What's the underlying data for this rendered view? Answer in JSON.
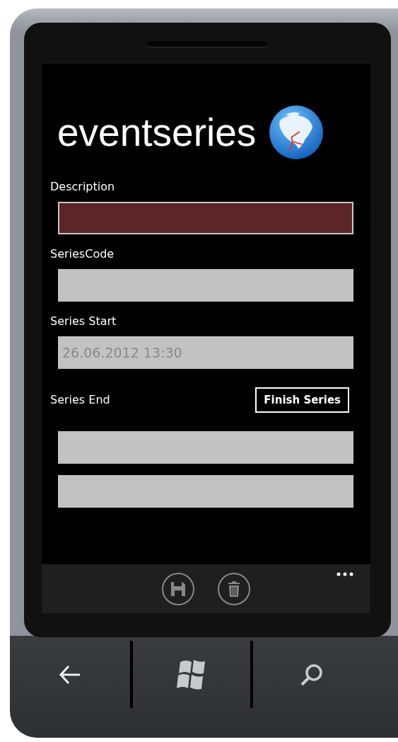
{
  "app": {
    "title": "eventseries"
  },
  "form": [
    {
      "kind": "label",
      "text": "Description"
    },
    {
      "kind": "field",
      "focused": true
    },
    {
      "kind": "label",
      "text": "SeriesCode"
    },
    {
      "kind": "field",
      "focused": false
    },
    {
      "kind": "label",
      "text": "Series Start"
    },
    {
      "kind": "field",
      "focused": false,
      "value": "26.06.2012 13:30"
    },
    {
      "kind": "label-button",
      "text": "Series End",
      "button": "Finish Series"
    },
    {
      "kind": "field",
      "focused": false
    },
    {
      "kind": "field",
      "focused": false
    }
  ],
  "app_bar": {
    "buttons": [
      {
        "kind": "save"
      },
      {
        "kind": "delete"
      }
    ]
  },
  "hardware_buttons": [
    {
      "kind": "back"
    },
    {
      "kind": "start"
    },
    {
      "kind": "search"
    }
  ]
}
